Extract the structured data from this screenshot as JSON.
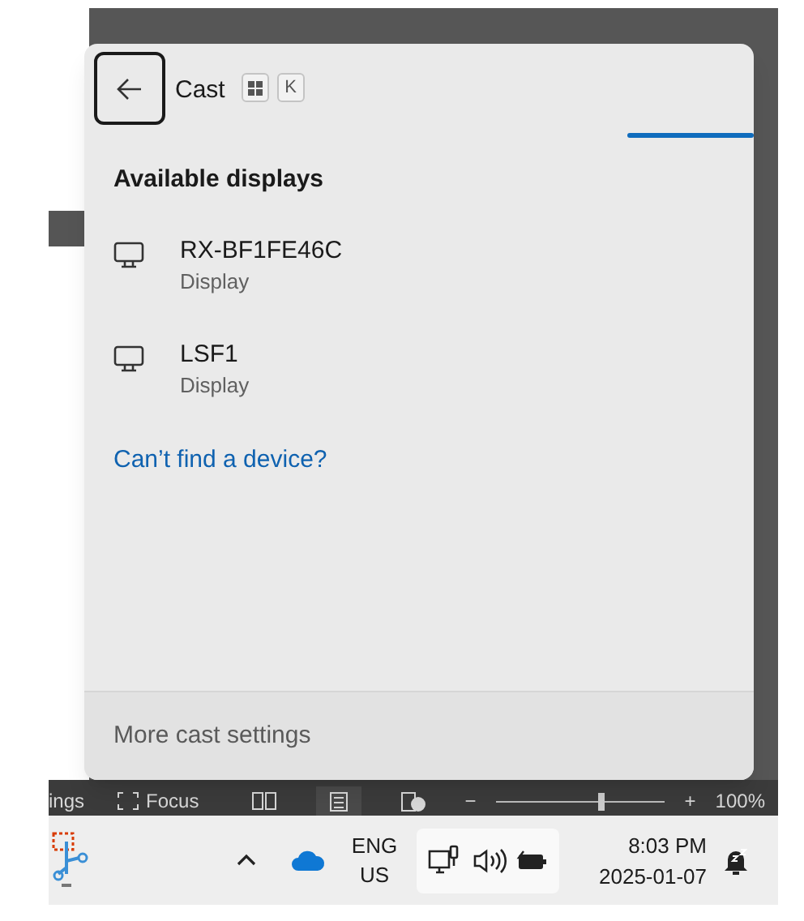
{
  "app_window": {
    "status_bar": {
      "settings_label": "ings",
      "focus_label": "Focus",
      "zoom": {
        "minus": "−",
        "plus": "+",
        "level": 0.6,
        "reading": "100%"
      }
    }
  },
  "flyout": {
    "back_button": {
      "focused": true
    },
    "title": "Cast",
    "shortcut_keys": [
      {
        "kind": "windows"
      },
      {
        "kind": "letter",
        "label": "K"
      }
    ],
    "searching": true,
    "section_title": "Available displays",
    "displays": [
      {
        "name": "RX-BF1FE46C",
        "type": "Display"
      },
      {
        "name": "LSF1",
        "type": "Display"
      }
    ],
    "help_link": "Can’t find a device?",
    "footer_link": "More cast settings"
  },
  "taskbar": {
    "language": {
      "line_1": "ENG",
      "line_2": "US"
    },
    "time": "8:03 PM",
    "date": "2025-01-07"
  }
}
